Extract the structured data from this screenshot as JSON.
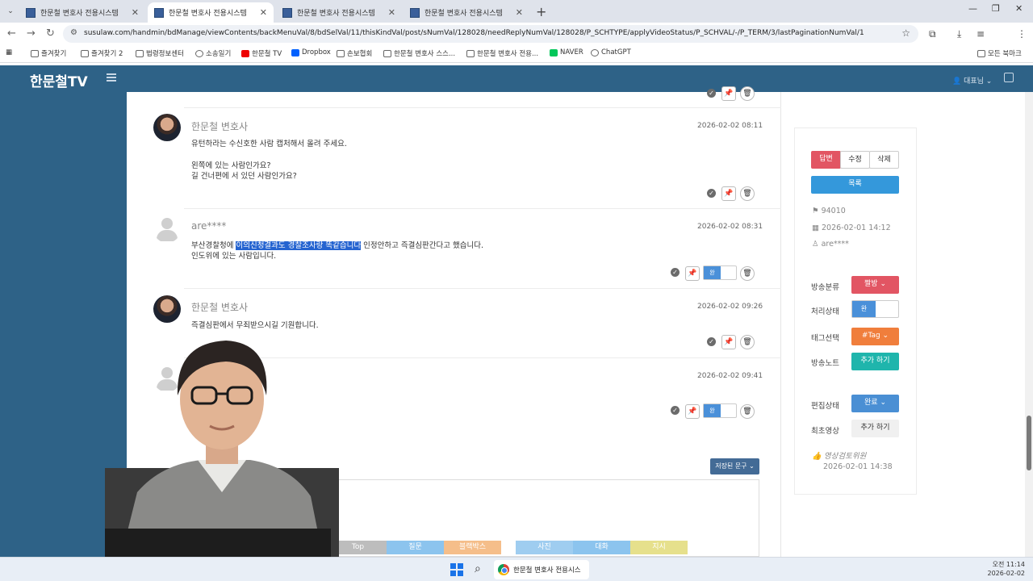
{
  "browser": {
    "tabs": [
      {
        "title": "한문철 변호사 전용시스템",
        "active": false
      },
      {
        "title": "한문철 변호사 전용시스템",
        "active": true
      },
      {
        "title": "한문철 변호사 전용시스템",
        "active": false
      },
      {
        "title": "한문철 변호사 전용시스템",
        "active": false
      }
    ],
    "url": "susulaw.com/handmin/bdManage/viewContents/backMenuVal/8/bdSelVal/11/thisKindVal/post/sNumVal/128028/needReplyNumVal/128028/P_SCHTYPE/applyVideoStatus/P_SCHVAL/-/P_TERM/3/lastPaginationNumVal/1",
    "bookmarks": [
      "즐겨찾기",
      "즐겨찾기 2",
      "법령정보센터",
      "소송일기",
      "한문철 TV",
      "Dropbox",
      "손보협회",
      "한문철 변호사 스스...",
      "한문철 변호사 전용...",
      "NAVER",
      "ChatGPT"
    ],
    "all_bookmarks": "모든 북마크"
  },
  "app": {
    "logo": "한문철TV",
    "user_menu": "대표님"
  },
  "comments": [
    {
      "author": "한문철 변호사",
      "date": "2026-02-02 08:11",
      "lines": [
        "유턴하라는 수신호한 사람 캡처해서 올려 주세요.",
        "",
        "왼쪽에 있는 사람인가요?",
        "길 건너편에 서 있던 사람인가요?"
      ]
    },
    {
      "author": "are****",
      "date": "2026-02-02 08:31",
      "line1_pre": "부산경찰청에 ",
      "line1_hl": "이의신청결과도 경찰조사랑 똑같습니다",
      "line1_post": " 인정안하고 즉결심판간다고 했습니다.",
      "line2": "인도위에 있는 사람입니다.",
      "toggle": "완"
    },
    {
      "author": "한문철 변호사",
      "date": "2026-02-02 09:26",
      "lines": [
        "즉결심판에서 무죄받으시길 기원합니다."
      ]
    },
    {
      "author": "",
      "date": "2026-02-02 09:41",
      "toggle": "완"
    }
  ],
  "editor": {
    "saved_phrases": "저장된 문구",
    "quick_buttons": [
      {
        "label": "Top",
        "color": "#bdbdbd"
      },
      {
        "label": "질문",
        "color": "#8cc4ee"
      },
      {
        "label": "블랙박스",
        "color": "#f5be8a"
      },
      {
        "label": "사진",
        "color": "#9fcdf0"
      },
      {
        "label": "대화",
        "color": "#8cc4ee"
      },
      {
        "label": "지시",
        "color": "#e6e08c"
      }
    ]
  },
  "panel": {
    "reply": "답변",
    "edit": "수정",
    "delete": "삭제",
    "list": "목록",
    "post_no": "94010",
    "post_date": "2026-02-01 14:12",
    "post_author": "are****",
    "labels": {
      "broadcast_category": "방송분류",
      "status": "처리상태",
      "tag": "태그선택",
      "note": "방송노트",
      "edit_status": "편집상태",
      "original": "최초영상"
    },
    "category_value": "짤방",
    "status_value": "완",
    "tag_value": "#Tag",
    "note_add": "추가 하기",
    "edit_status_value": "완료",
    "original_add": "추가 하기",
    "reviewer": "영상검토위원",
    "reviewer_date": "2026-02-01 14:38"
  },
  "taskbar": {
    "app_label": "한문철 변호사 전용시스",
    "time": "오전 11:14",
    "date": "2026-02-02"
  }
}
